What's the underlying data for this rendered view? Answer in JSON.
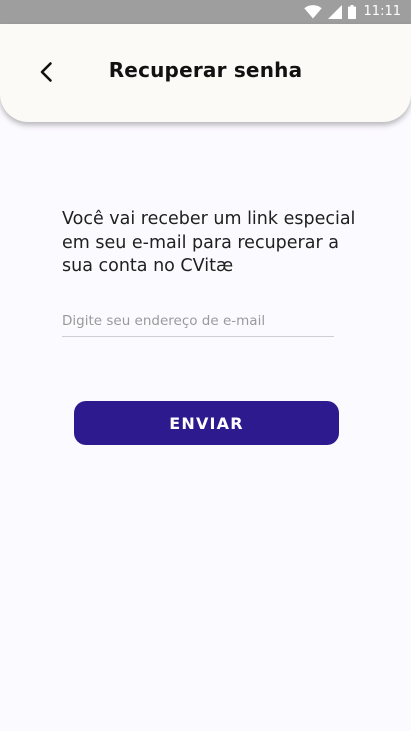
{
  "status_bar": {
    "time": "11:11",
    "icons": [
      "wifi-icon",
      "cell-signal-icon",
      "battery-icon"
    ]
  },
  "header": {
    "title": "Recuperar senha",
    "back_icon": "chevron-left-icon"
  },
  "content": {
    "description": "Você vai receber um link especial em seu e-mail para recuperar a sua conta no CVitæ",
    "email_placeholder": "Digite seu endereço de e-mail",
    "email_value": "",
    "send_label": "ENVIAR"
  },
  "colors": {
    "primary": "#2e1a8f",
    "background": "#fbfaff",
    "status_bar": "#9e9e9e"
  }
}
